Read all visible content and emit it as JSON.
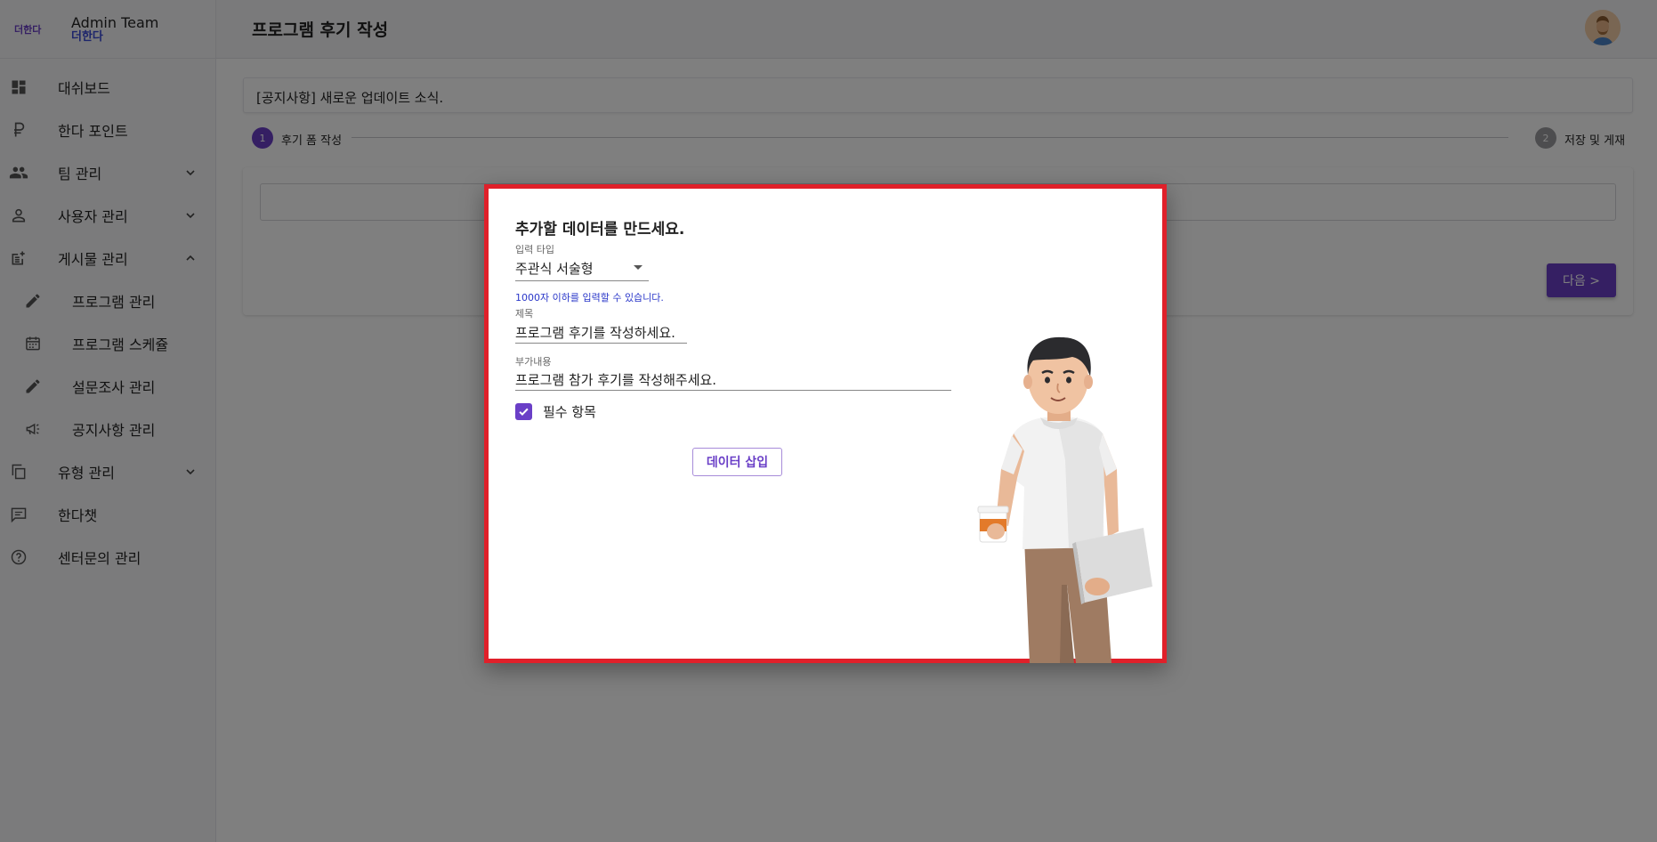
{
  "brand": {
    "logo_text": "더한다",
    "team": "Admin Team",
    "sub": "더한다"
  },
  "sidebar": {
    "items": [
      {
        "label": "대쉬보드",
        "icon": "dashboard-icon"
      },
      {
        "label": "한다 포인트",
        "icon": "ruble-icon"
      },
      {
        "label": "팀 관리",
        "icon": "group-icon"
      },
      {
        "label": "사용자 관리",
        "icon": "person-icon"
      },
      {
        "label": "게시물 관리",
        "icon": "post-add-icon"
      },
      {
        "label": "프로그램 관리",
        "icon": "pencil-icon"
      },
      {
        "label": "프로그램 스케쥴",
        "icon": "calendar-icon"
      },
      {
        "label": "설문조사 관리",
        "icon": "pencil-icon"
      },
      {
        "label": "공지사항 관리",
        "icon": "megaphone-icon"
      },
      {
        "label": "유형 관리",
        "icon": "copy-icon"
      },
      {
        "label": "한다챗",
        "icon": "chat-icon"
      },
      {
        "label": "센터문의 관리",
        "icon": "help-icon"
      }
    ]
  },
  "header": {
    "title": "프로그램 후기 작성"
  },
  "notice": {
    "text": "[공지사항] 새로운 업데이트 소식."
  },
  "stepper": {
    "steps": [
      {
        "number": "1",
        "label": "후기 폼 작성"
      },
      {
        "number": "2",
        "label": "저장 및 게재"
      }
    ]
  },
  "form": {
    "next_label": "다음 >"
  },
  "modal": {
    "title": "추가할 데이터를 만드세요.",
    "input_type_label": "입력 타입",
    "input_type_value": "주관식 서술형",
    "helper_text": "1000자 이하를 입력할 수 있습니다.",
    "title_label": "제목",
    "title_value": "프로그램 후기를 작성하세요.",
    "extra_label": "부가내용",
    "extra_value": "프로그램 참가 후기를 작성해주세요.",
    "required_label": "필수 항목",
    "insert_label": "데이터 삽입"
  },
  "colors": {
    "primary": "#6a3fc7",
    "modal_border": "#e0202a",
    "helper": "#2a37c9"
  }
}
